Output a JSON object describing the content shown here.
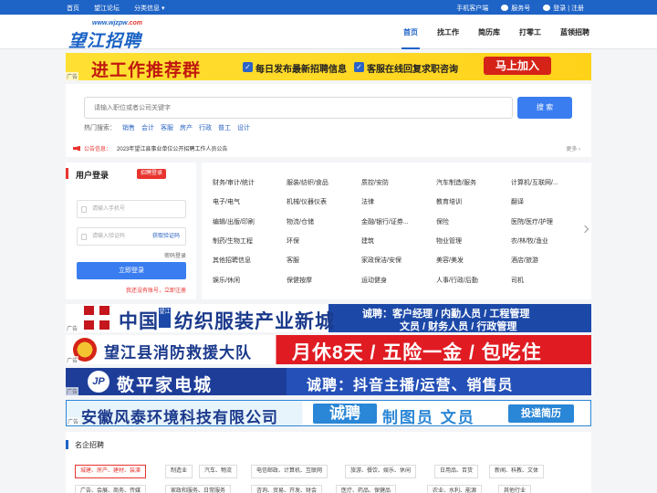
{
  "topbar": {
    "links": [
      "首页",
      "望江论坛",
      "分类信息"
    ],
    "mobile": "手机客户端",
    "service": "服务号",
    "login": "登录",
    "sep": "|",
    "register": "注册"
  },
  "header": {
    "logo_url_prefix": "www.wjzpw",
    "logo_url_suffix": ".com",
    "logo_text": "望江招聘网",
    "nav": [
      "首页",
      "找工作",
      "简历库",
      "打零工",
      "蓝领招聘"
    ]
  },
  "ad_top": {
    "title": "进工作推荐群",
    "point1": "每日发布最新招聘信息",
    "point2": "客服在线回复求职咨询",
    "button": "马上加入",
    "tag": "广告"
  },
  "search": {
    "placeholder": "请输入职位或者公司关键字",
    "button": "搜 索",
    "hot_label": "热门搜索：",
    "hot": [
      "销售",
      "会计",
      "客服",
      "房产",
      "行政",
      "普工",
      "设计"
    ]
  },
  "notice": {
    "label": "公告信息：",
    "text": "2023年望江县事业单位公开招聘工作人员公告",
    "more": "更多 ›"
  },
  "login": {
    "title": "用户登录",
    "employer_tag": "招聘登录",
    "phone_placeholder": "请输入手机号",
    "code_placeholder": "请输入验证码",
    "get_code": "获取验证码",
    "pwd_login": "密码登录",
    "submit": "立即登录",
    "register_tip": "我还没有账号，立即注册"
  },
  "categories": [
    "财务/审计/统计",
    "服装/纺织/食品",
    "质控/安防",
    "汽车制造/服务",
    "计算机/互联网/...",
    "电子/电气",
    "机械/仪器仪表",
    "法律",
    "教育培训",
    "翻译",
    "编辑/出版/印刷",
    "物流/仓储",
    "金融/银行/证券...",
    "保险",
    "医院/医疗/护理",
    "制药/生物工程",
    "环保",
    "建筑",
    "物业管理",
    "农/林/牧/渔业",
    "其他招聘信息",
    "客服",
    "家政保洁/安保",
    "美容/美发",
    "酒店/旅游",
    "娱乐/休闲",
    "保健按摩",
    "运动健身",
    "人事/行政/后勤",
    "司机"
  ],
  "ads": {
    "a2_title": "中国",
    "a2_tiny": "望江",
    "a2_title2": "纺织服装产业新城",
    "a2_line1": "诚聘：客户经理 / 内勤人员 / 工程管理",
    "a2_line2": "文员 / 财务人员 / 行政管理",
    "a3_title": "望江县消防救援大队",
    "a3_slogan": "月休8天 / 五险一金 / 包吃住",
    "a4_logo": "JP",
    "a4_title": "敬平家电城",
    "a4_slogan": "诚聘：抖音主播/运营、销售员",
    "a5_title": "安徽风泰环境科技有限公司",
    "a5_hire": "诚聘",
    "a5_jobs": "制图员 文员",
    "a5_button": "投递简历",
    "tag": "广告"
  },
  "famous": {
    "title": "名企招聘",
    "tags": [
      "城建、房产、建材、装潢",
      "制造业",
      "汽车、物流",
      "电信邮政、计算机、互联网",
      "旅游、餐饮、娱乐、休闲",
      "日用品、百货",
      "新闻、科教、文体",
      "广告、会展、商务、传媒",
      "家政和服务、日常服务",
      "咨询、贸易、开发、财会",
      "医疗、药品、保健品",
      "农业、水利、能源",
      "其他行业"
    ]
  },
  "colors": {
    "primary": "#1e63c6",
    "accent": "#e8342f",
    "button": "#3a7df0"
  }
}
